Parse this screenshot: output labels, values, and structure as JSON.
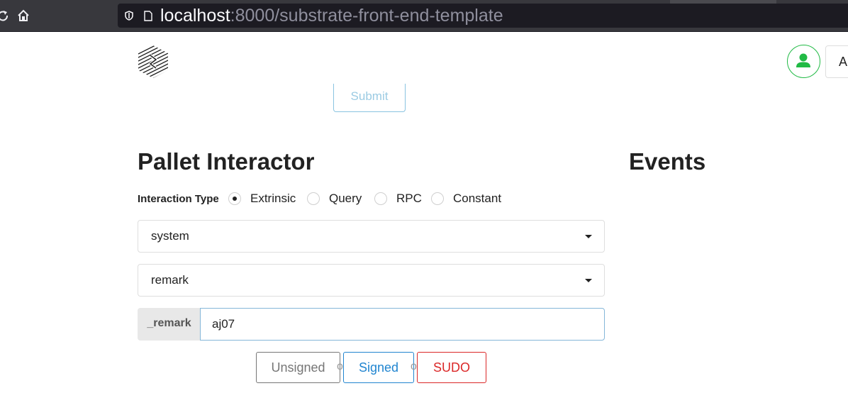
{
  "browser": {
    "url_host": "localhost",
    "url_rest": ":8000/substrate-front-end-template",
    "icons": [
      "reload-icon",
      "home-icon",
      "shield-icon",
      "page-icon"
    ]
  },
  "header": {
    "logo": "substrate-logo",
    "account_icon": "user-icon",
    "account_label": "A"
  },
  "submit_button": {
    "label": "Submit"
  },
  "pallet": {
    "title": "Pallet Interactor",
    "interaction_type_label": "Interaction Type",
    "interaction_types": [
      {
        "label": "Extrinsic",
        "selected": true
      },
      {
        "label": "Query",
        "selected": false
      },
      {
        "label": "RPC",
        "selected": false
      },
      {
        "label": "Constant",
        "selected": false
      }
    ],
    "pallet_select": "system",
    "callable_select": "remark",
    "param_label": "_remark",
    "param_value": "aj07",
    "buttons": {
      "unsigned": "Unsigned",
      "or1": "or",
      "signed": "Signed",
      "or2": "or",
      "sudo": "SUDO"
    }
  },
  "events": {
    "title": "Events"
  },
  "colors": {
    "chrome_bg": "#38383d",
    "urlbar_bg": "#1c1b22",
    "green": "#21ba45",
    "blue": "#2185d0",
    "red": "#db2828",
    "grey": "#767676"
  }
}
